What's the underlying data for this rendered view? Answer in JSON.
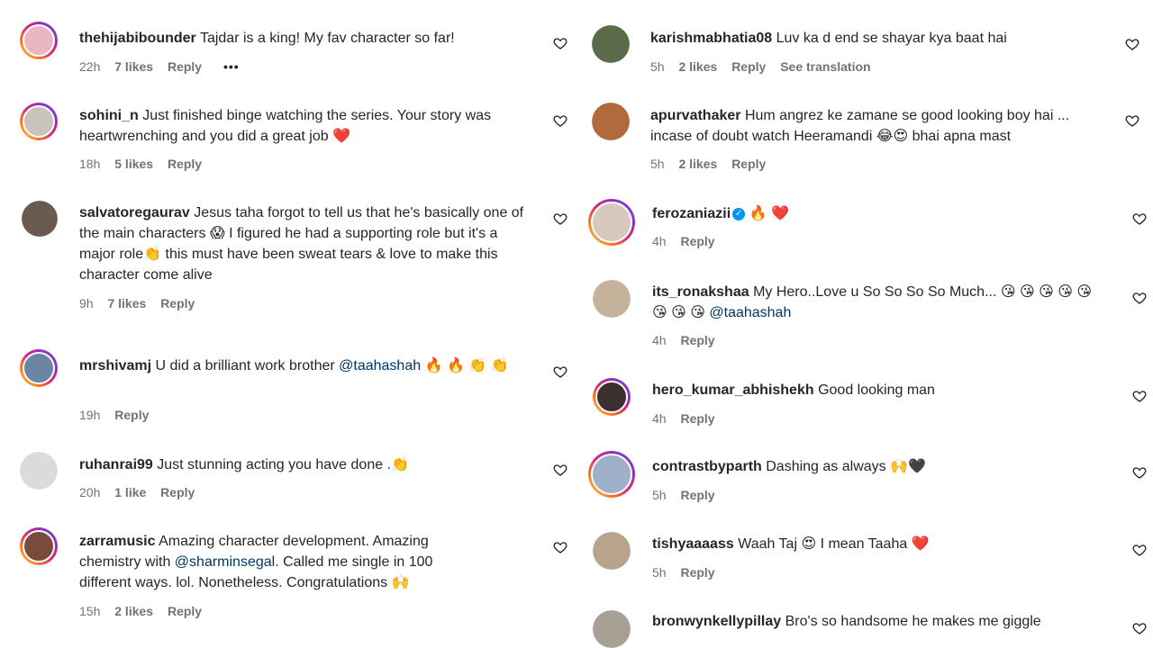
{
  "left": [
    {
      "user": "thehijabibounder",
      "text": "Tajdar is a king! My fav character so far!",
      "time": "22h",
      "likes": "7 likes",
      "reply": "Reply",
      "more": "•••",
      "avatar_color": "#e9b7c3",
      "ring": true
    },
    {
      "user": "sohini_n",
      "text": "Just finished binge watching the series. Your story was heartwrenching and you did a great job ❤️",
      "time": "18h",
      "likes": "5 likes",
      "reply": "Reply",
      "avatar_color": "#c9c3bd",
      "ring": true
    },
    {
      "user": "salvatoregaurav",
      "text": "Jesus taha forgot to tell us that he's basically one of the main characters 😱 I figured he had a supporting role but it's a major role👏 this must have been sweat tears & love to make this character come alive",
      "time": "9h",
      "likes": "7 likes",
      "reply": "Reply",
      "avatar_color": "#6b5a4f",
      "ring": false
    },
    {
      "user": "mrshivamj",
      "text_parts": [
        "U did a brilliant work brother ",
        "@taahashah",
        " 🔥 🔥 👏 👏"
      ],
      "time": "19h",
      "reply": "Reply",
      "avatar_color": "#6b86a3",
      "ring": true
    },
    {
      "user": "ruhanrai99",
      "text": "Just stunning acting you have done .👏",
      "time": "20h",
      "likes": "1 like",
      "reply": "Reply",
      "avatar_color": "#dbdbdb",
      "ring": false
    },
    {
      "user": "zarramusic",
      "text_parts": [
        "Amazing character development. Amazing chemistry with ",
        "@sharminsegal",
        ". Called me single in 100 different ways. lol. Nonetheless. Congratulations 🙌"
      ],
      "time": "15h",
      "likes": "2 likes",
      "reply": "Reply",
      "avatar_color": "#7a4a3a",
      "ring": true
    }
  ],
  "right": [
    {
      "user": "karishmabhatia08",
      "text": "Luv ka d end se shayar kya baat hai",
      "time": "5h",
      "likes": "2 likes",
      "reply": "Reply",
      "translate": "See translation",
      "avatar_color": "#5a6b4a",
      "ring": false
    },
    {
      "user": "apurvathaker",
      "text": "Hum angrez ke zamane se good looking boy hai ... incase of doubt watch Heeramandi 😂😍 bhai apna mast",
      "time": "5h",
      "likes": "2 likes",
      "reply": "Reply",
      "avatar_color": "#b06a3b",
      "ring": false
    },
    {
      "user": "ferozaniazii",
      "text": "🔥 ❤️",
      "time": "4h",
      "reply": "Reply",
      "avatar_color": "#d8c9bf",
      "ring": true,
      "verified": true
    },
    {
      "user": "its_ronakshaa",
      "text_parts": [
        "My Hero..Love u So So So So Much... 😘 😘 😘 😘 😘 😘 😘 😘 ",
        "@taahashah"
      ],
      "time": "4h",
      "reply": "Reply",
      "avatar_color": "#c4b39a",
      "ring": false
    },
    {
      "user": "hero_kumar_abhishekh",
      "text": "Good looking man",
      "time": "4h",
      "reply": "Reply",
      "avatar_color": "#3b2f2f",
      "ring": true
    },
    {
      "user": "contrastbyparth",
      "text": "Dashing as always 🙌🖤",
      "time": "5h",
      "reply": "Reply",
      "avatar_color": "#9fb1c8",
      "ring": true
    },
    {
      "user": "tishyaaaass",
      "text": "Waah Taj 😍 I mean Taaha ❤️",
      "time": "5h",
      "reply": "Reply",
      "avatar_color": "#b7a48a",
      "ring": false
    },
    {
      "user": "bronwynkellypillay",
      "text": "Bro's so handsome he makes me giggle",
      "avatar_color": "#a89f95",
      "ring": false
    }
  ]
}
